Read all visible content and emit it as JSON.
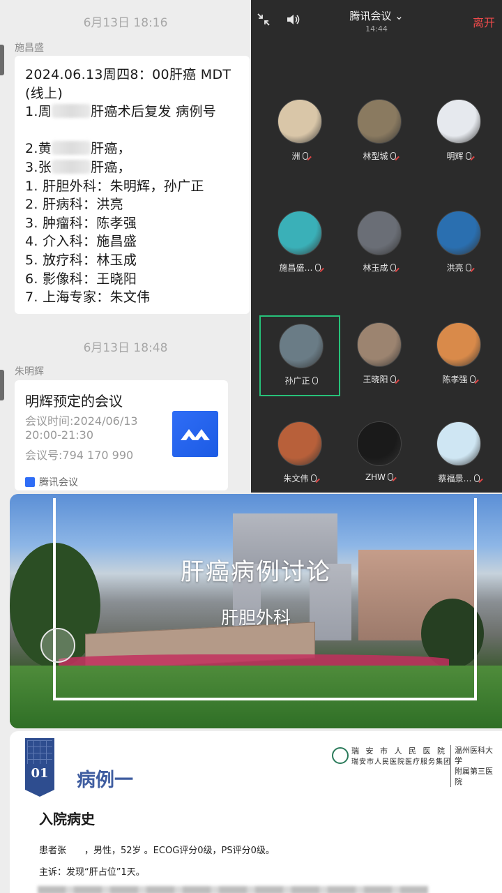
{
  "chat": {
    "msg1": {
      "time": "6月13日 18:16",
      "sender": "施昌盛",
      "lines": [
        "2024.06.13周四8：00肝癌 MDT",
        "(线上)",
        "1.周",
        "肝癌术后复发 病例号",
        "",
        "2.黄",
        "肝癌，",
        "3.张",
        "肝癌，",
        "1. 肝胆外科：朱明辉，孙广正",
        "2. 肝病科：洪亮",
        "3. 肿瘤科：陈孝强",
        "4. 介入科：施昌盛",
        "5. 放疗科：林玉成",
        "6. 影像科：王晓阳",
        "7. 上海专家：朱文伟"
      ]
    },
    "msg2": {
      "time": "6月13日 18:48",
      "sender": "朱明辉",
      "card": {
        "title": "明辉预定的会议",
        "meeting_time": "会议时间:2024/06/13",
        "time_range": "20:00-21:30",
        "meeting_id": "会议号:794 170 990",
        "app": "腾讯会议"
      }
    }
  },
  "meeting": {
    "title": "腾讯会议",
    "clock": "14:44",
    "leave": "离开",
    "participants": [
      {
        "name": "洲",
        "muted": true,
        "color": "#d9c6a8"
      },
      {
        "name": "林型城",
        "muted": true,
        "color": "#8a7a60"
      },
      {
        "name": "明辉",
        "muted": true,
        "color": "#e6e9ee"
      },
      {
        "name": "施昌盛…",
        "muted": true,
        "color": "#3ab0b8"
      },
      {
        "name": "林玉成",
        "muted": true,
        "color": "#6a6e76"
      },
      {
        "name": "洪亮",
        "muted": true,
        "color": "#2a6fb0"
      },
      {
        "name": "孙广正",
        "muted": false,
        "color": "#6a7c86"
      },
      {
        "name": "王晓阳",
        "muted": true,
        "color": "#9c8470"
      },
      {
        "name": "陈孝强",
        "muted": true,
        "color": "#d98a4a"
      },
      {
        "name": "朱文伟",
        "muted": true,
        "color": "#b8603a"
      },
      {
        "name": "ZHW",
        "muted": true,
        "color": "#1a1a1a"
      },
      {
        "name": "蔡福景…",
        "muted": true,
        "color": "#cfe6f3"
      }
    ]
  },
  "banner": {
    "title": "肝癌病例讨论",
    "subtitle": "肝胆外科"
  },
  "case": {
    "number": "01",
    "title": "病例一",
    "logo_line1": "瑞 安 市 人 民 医 院",
    "logo_line2": "瑞安市人民医院医疗服务集团",
    "logo_line3a": "温州医科大学",
    "logo_line3b": "附属第三医院",
    "heading": "入院病史",
    "patient": "患者张　　，男性，52岁 。ECOG评分0级，PS评分0级。",
    "complaint": "主诉：发现“肝占位”1天。"
  }
}
